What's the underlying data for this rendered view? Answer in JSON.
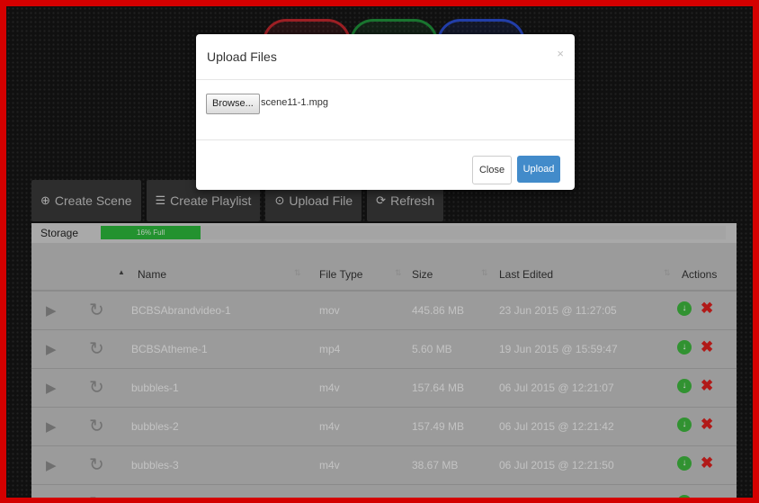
{
  "toolbar": {
    "create_scene": "Create Scene",
    "create_playlist": "Create Playlist",
    "upload_file": "Upload File",
    "refresh": "Refresh",
    "icons": [
      "plus-circle-icon",
      "list-icon",
      "upload-circle-icon",
      "refresh-icon"
    ]
  },
  "storage": {
    "label": "Storage",
    "fill_text": "16% Full",
    "fill_fraction": 0.16,
    "fill_color": "#2bb33a"
  },
  "table": {
    "headers": {
      "name": "Name",
      "file_type": "File Type",
      "size": "Size",
      "last_edited": "Last Edited",
      "actions": "Actions"
    },
    "rows": [
      {
        "name": "BCBSAbrandvideo-1",
        "type": "mov",
        "size": "445.86 MB",
        "edited": "23 Jun 2015 @ 11:27:05"
      },
      {
        "name": "BCBSAtheme-1",
        "type": "mp4",
        "size": "5.60 MB",
        "edited": "19 Jun 2015 @ 15:59:47"
      },
      {
        "name": "bubbles-1",
        "type": "m4v",
        "size": "157.64 MB",
        "edited": "06 Jul 2015 @ 12:21:07"
      },
      {
        "name": "bubbles-2",
        "type": "m4v",
        "size": "157.49 MB",
        "edited": "06 Jul 2015 @ 12:21:42"
      },
      {
        "name": "bubbles-3",
        "type": "m4v",
        "size": "38.67 MB",
        "edited": "06 Jul 2015 @ 12:21:50"
      }
    ]
  },
  "modal": {
    "title": "Upload Files",
    "close_x": "×",
    "browse_label": "Browse...",
    "file_name": "scene11-1.mpg",
    "close_label": "Close",
    "upload_label": "Upload"
  },
  "colors": {
    "frame": "#d40000",
    "download": "#3cb23c",
    "delete": "#d8201e",
    "primary": "#428bca"
  }
}
